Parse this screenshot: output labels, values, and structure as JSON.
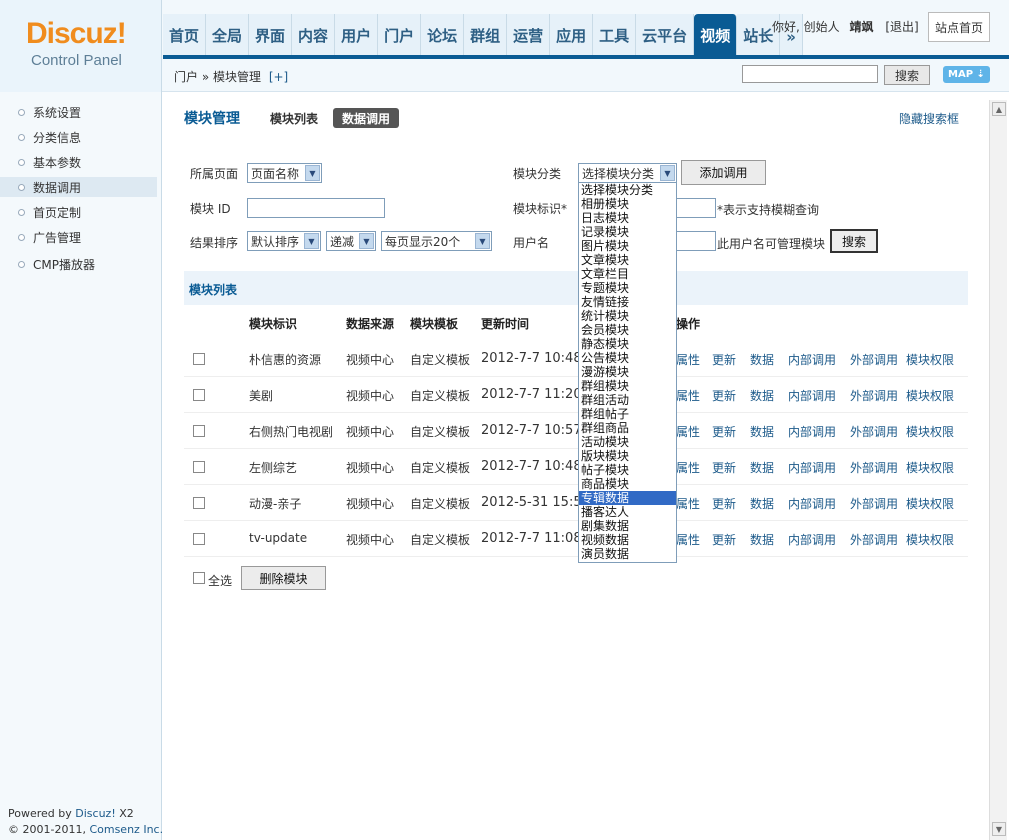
{
  "logo": {
    "brand": "Discuz!",
    "sub": "Control Panel"
  },
  "nav": {
    "items": [
      {
        "label": "首页",
        "active": false
      },
      {
        "label": "全局",
        "active": false
      },
      {
        "label": "界面",
        "active": false
      },
      {
        "label": "内容",
        "active": false
      },
      {
        "label": "用户",
        "active": false
      },
      {
        "label": "门户",
        "active": false
      },
      {
        "label": "论坛",
        "active": false
      },
      {
        "label": "群组",
        "active": false
      },
      {
        "label": "运营",
        "active": false
      },
      {
        "label": "应用",
        "active": false
      },
      {
        "label": "工具",
        "active": false
      },
      {
        "label": "云平台",
        "active": false
      },
      {
        "label": "视频",
        "active": true
      },
      {
        "label": "站长",
        "active": false
      },
      {
        "label": "»",
        "active": false
      }
    ]
  },
  "user": {
    "greeting": "你好, 创始人",
    "name": "靖飒",
    "logout": "[退出]",
    "home": "站点首页"
  },
  "breadcrumb": {
    "path": "门户 » 模块管理",
    "add": "[+]"
  },
  "topsearch": {
    "value": "",
    "button": "搜索",
    "map": "MAP ⇣"
  },
  "sidebar": {
    "items": [
      {
        "label": "系统设置",
        "active": false
      },
      {
        "label": "分类信息",
        "active": false
      },
      {
        "label": "基本参数",
        "active": false
      },
      {
        "label": "数据调用",
        "active": true
      },
      {
        "label": "首页定制",
        "active": false
      },
      {
        "label": "广告管理",
        "active": false
      },
      {
        "label": "CMP播放器",
        "active": false
      }
    ],
    "powered_prefix": "Powered by ",
    "powered_brand": "Discuz!",
    "powered_ver": " X2",
    "copyright_prefix": "© 2001-2011, ",
    "copyright_brand": "Comsenz Inc."
  },
  "main": {
    "title": "模块管理",
    "tab_list": "模块列表",
    "tab_data": "数据调用",
    "hide_search": "隐藏搜索框"
  },
  "filters": {
    "page_label": "所属页面",
    "page_value": "页面名称",
    "category_label": "模块分类",
    "category_value": "选择模块分类",
    "add_button": "添加调用",
    "module_id_label": "模块 ID",
    "module_id_value": "",
    "module_tag_label": "模块标识*",
    "module_tag_value": "",
    "fuzzy_hint": "*表示支持模糊查询",
    "sort_label": "结果排序",
    "sort_value": "默认排序",
    "order_value": "递减",
    "per_page_value": "每页显示20个",
    "username_label": "用户名",
    "username_value": "",
    "username_hint": "此用户名可管理模块",
    "search_button": "搜索"
  },
  "dropdown": {
    "options": [
      "选择模块分类",
      "相册模块",
      "日志模块",
      "记录模块",
      "图片模块",
      "文章模块",
      "文章栏目",
      "专题模块",
      "友情链接",
      "统计模块",
      "会员模块",
      "静态模块",
      "公告模块",
      "漫游模块",
      "群组模块",
      "群组活动",
      "群组帖子",
      "群组商品",
      "活动模块",
      "版块模块",
      "帖子模块",
      "商品模块",
      "专辑数据",
      "播客达人",
      "剧集数据",
      "视频数据",
      "演员数据"
    ],
    "highlighted": "专辑数据"
  },
  "table": {
    "caption": "模块列表",
    "headers": {
      "tag": "模块标识",
      "source": "数据来源",
      "template": "模块模板",
      "updated": "更新时间",
      "ops": "操作"
    },
    "action_labels": [
      "属性",
      "更新",
      "数据",
      "内部调用",
      "外部调用",
      "模块权限"
    ],
    "rows": [
      {
        "tag": "朴信惠的资源",
        "source": "视频中心",
        "template": "自定义模板",
        "updated": "2012-7-7 10:48"
      },
      {
        "tag": "美剧",
        "source": "视频中心",
        "template": "自定义模板",
        "updated": "2012-7-7 11:20"
      },
      {
        "tag": "右侧热门电视剧",
        "source": "视频中心",
        "template": "自定义模板",
        "updated": "2012-7-7 10:57"
      },
      {
        "tag": "左侧综艺",
        "source": "视频中心",
        "template": "自定义模板",
        "updated": "2012-7-7 10:48"
      },
      {
        "tag": "动漫-亲子",
        "source": "视频中心",
        "template": "自定义模板",
        "updated": "2012-5-31 15:5"
      },
      {
        "tag": "tv-update",
        "source": "视频中心",
        "template": "自定义模板",
        "updated": "2012-7-7 11:08"
      }
    ],
    "select_all": "全选",
    "delete_button": "删除模块"
  },
  "colors": {
    "accent": "#0a5b94",
    "logo_orange": "#f08c1e",
    "logo_blue": "#3a7fb8",
    "link": "#1c5a8a",
    "highlight": "#316ac5"
  }
}
